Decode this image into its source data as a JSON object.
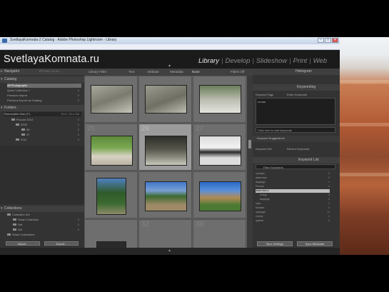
{
  "window": {
    "title": "SvetlayaKomnata-2 Catalog - Adobe Photoshop Lightroom - Library",
    "buttons": {
      "minimize": "–",
      "maximize": "□",
      "close": "✕"
    }
  },
  "menu": [
    "File",
    "Edit",
    "Library",
    "Photo",
    "Metadata",
    "View",
    "Window",
    "Help"
  ],
  "identity_plate": "SvetlayaKomnata.ru",
  "modules": {
    "items": [
      "Library",
      "Develop",
      "Slideshow",
      "Print",
      "Web"
    ],
    "active": "Library",
    "separator": "|"
  },
  "left_panel": {
    "navigator": {
      "title": "Navigator",
      "zoom_options": "FIT  FILL  1:1  3:1"
    },
    "catalog": {
      "title": "Catalog",
      "items": [
        {
          "label": "All Photographs",
          "count": "1"
        },
        {
          "label": "Quick Collection +",
          "count": "0"
        },
        {
          "label": "Previous Import",
          "count": "0"
        },
        {
          "label": "Previous Export as Catalog",
          "count": "0"
        }
      ]
    },
    "folders": {
      "title": "Folders",
      "volume": "Removable Disk (F:)",
      "volume_info": "19.6 / 29.4 GB",
      "items": [
        {
          "label": "Россия 2010",
          "count": "0"
        },
        {
          "label": "2009",
          "count": "0"
        },
        {
          "label": "06",
          "count": "0"
        },
        {
          "label": "07",
          "count": "0"
        },
        {
          "label": "2011",
          "count": "0"
        }
      ]
    },
    "collections": {
      "title": "Collections",
      "items": [
        {
          "label": "Collection Set",
          "count": ""
        },
        {
          "label": "Smart Collection",
          "count": "0"
        },
        {
          "label": "Set",
          "count": "0"
        },
        {
          "label": "Set",
          "count": "0"
        },
        {
          "label": "Smart Collections",
          "count": ""
        }
      ]
    },
    "import_button": "Import...",
    "export_button": "Export..."
  },
  "filter_bar": {
    "title": "Library Filter :",
    "options": [
      "Text",
      "Attribute",
      "Metadata",
      "None"
    ],
    "active": "None",
    "preset": "Filters Off"
  },
  "grid": {
    "cells": [
      {
        "index": "",
        "photo": "polar-bear-rocks",
        "selected": false
      },
      {
        "index": "",
        "photo": "polar-bear-rocks-2",
        "selected": false
      },
      {
        "index": "",
        "photo": "polar-bear-walking",
        "selected": false
      },
      {
        "index": "25",
        "photo": "garden-statue",
        "selected": false
      },
      {
        "index": "26",
        "photo": "animals-rocks",
        "selected": true
      },
      {
        "index": "27",
        "photo": "bird-snow",
        "selected": false
      },
      {
        "index": "",
        "photo": "tree-park",
        "selected": false
      },
      {
        "index": "",
        "photo": "building-trees",
        "selected": false
      },
      {
        "index": "",
        "photo": "building-lawn",
        "selected": false
      },
      {
        "index": "",
        "photo": "dark",
        "selected": false
      },
      {
        "index": "32",
        "photo": "empty",
        "selected": false
      },
      {
        "index": "33",
        "photo": "empty",
        "selected": false
      }
    ]
  },
  "right_panel": {
    "histogram": {
      "title": "Histogram"
    },
    "keywording": {
      "title": "Keywording",
      "keyword_tags_label": "Keyword Tags",
      "keyword_tags_value": "Enter Keywords",
      "tags_text": "слова",
      "add_placeholder": "Click here to add keywords",
      "suggestions": "Keyword Suggestions",
      "keyword_set_label": "Keyword Set",
      "keyword_set_value": "Recent Keywords"
    },
    "keyword_list": {
      "title": "Keyword List",
      "filter": "Filter Keywords",
      "items": [
        {
          "label": "зоопарк",
          "count": "0",
          "selected": false
        },
        {
          "label": "животные",
          "count": "0",
          "selected": false
        },
        {
          "label": "медведь",
          "count": "1",
          "selected": false
        },
        {
          "label": "Россия",
          "count": "0",
          "selected": false
        },
        {
          "label": "животные ▸",
          "count": "1",
          "selected": true
        },
        {
          "label": "птицы",
          "count": "0",
          "selected": false
        },
        {
          "label": "медведь",
          "count": "0",
          "selected": false
        },
        {
          "label": "парк",
          "count": "0",
          "selected": false
        },
        {
          "label": "Москва",
          "count": "0",
          "selected": false
        },
        {
          "label": "природа",
          "count": "14",
          "selected": false
        },
        {
          "label": "статуя",
          "count": "0",
          "selected": false
        },
        {
          "label": "здание",
          "count": "0",
          "selected": false
        }
      ]
    },
    "sync_settings": "Sync Settings",
    "sync_metadata": "Sync Metadata"
  }
}
